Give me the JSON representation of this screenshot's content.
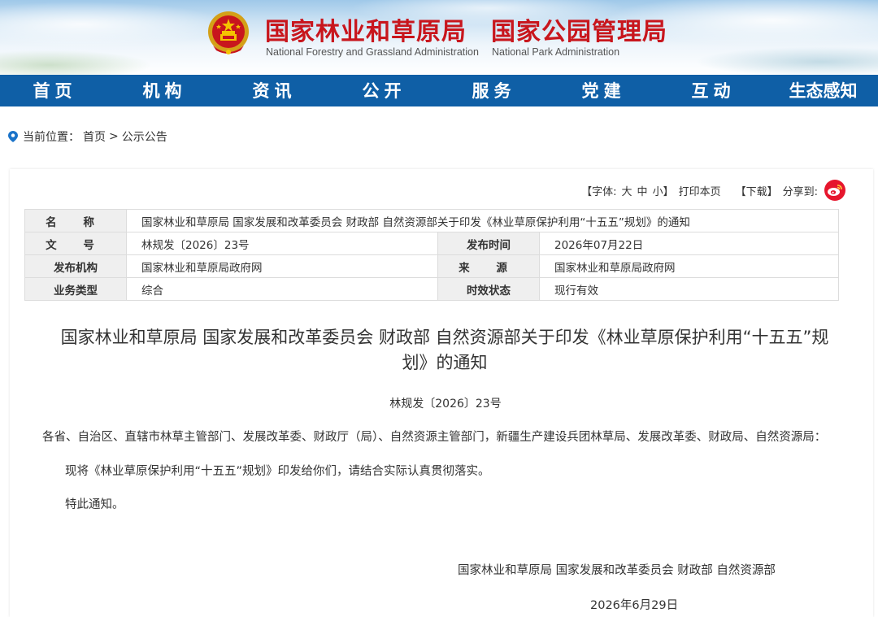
{
  "header": {
    "title_cn_1": "国家林业和草原局",
    "title_cn_2": "国家公园管理局",
    "title_en_1": "National Forestry and Grassland Administration",
    "title_en_2": "National Park Administration",
    "emblem_icon": "national-emblem-icon"
  },
  "nav": {
    "items": [
      "首页",
      "机构",
      "资讯",
      "公开",
      "服务",
      "党建",
      "互动",
      "生态感知"
    ]
  },
  "breadcrumb": {
    "prefix": "当前位置：",
    "home": "首页",
    "sep": ">",
    "current": "公示公告"
  },
  "tools": {
    "font_open": "【字体:",
    "font_large": "大",
    "font_medium": "中",
    "font_small": "小】",
    "print": "打印本页",
    "download": "【下载】",
    "share": "分享到:",
    "weibo_icon": "weibo-icon"
  },
  "meta": {
    "name_label": "名 称",
    "name_value": "国家林业和草原局 国家发展和改革委员会 财政部 自然资源部关于印发《林业草原保护利用“十五五”规划》的通知",
    "docno_label": "文 号",
    "docno_value": "林规发〔2026〕23号",
    "pubdate_label": "发布时间",
    "pubdate_value": "2026年07月22日",
    "org_label": "发布机构",
    "org_value": "国家林业和草原局政府网",
    "source_label": "来 源",
    "source_value": "国家林业和草原局政府网",
    "type_label": "业务类型",
    "type_value": "综合",
    "status_label": "时效状态",
    "status_value": "现行有效"
  },
  "article": {
    "headline_1": "国家林业和草原局 国家发展和改革委员会 财政部 自然资源部关于印发《林业草原保护利用“十五五”规",
    "headline_2": "划》的通知",
    "docno": "林规发〔2026〕23号",
    "para_1": "各省、自治区、直辖市林草主管部门、发展改革委、财政厅（局）、自然资源主管部门，新疆生产建设兵团林草局、发展改革委、财政局、自然资源局：",
    "para_2": "现将《林业草原保护利用“十五五”规划》印发给你们，请结合实际认真贯彻落实。",
    "para_3": "特此通知。",
    "signature": "国家林业和草原局 国家发展和改革委员会 财政部 自然资源部",
    "date": "2026年6月29日"
  },
  "colors": {
    "brand_red": "#c8161d",
    "nav_blue": "#0f5fa6",
    "weibo_red": "#e6162d"
  }
}
